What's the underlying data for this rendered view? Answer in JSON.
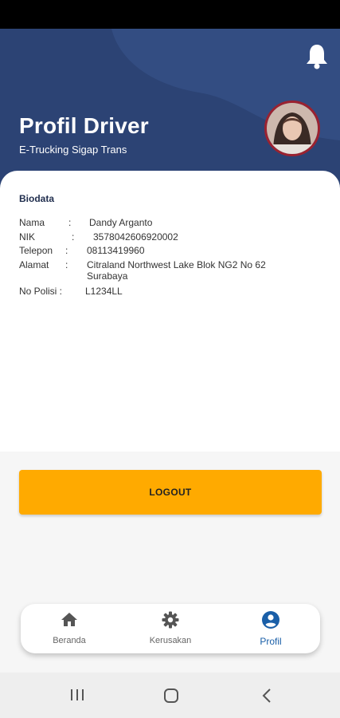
{
  "header": {
    "title": "Profil Driver",
    "subtitle": "E-Trucking Sigap Trans",
    "bg_color": "#2c4374",
    "wave_color": "#334d82",
    "notification_icon": "bell-icon"
  },
  "avatar": {
    "border_color": "#9b2230"
  },
  "biodata": {
    "title": "Biodata",
    "rows": [
      {
        "label": "Nama",
        "sep": ":",
        "value": "Dandy Arganto"
      },
      {
        "label": "NIK",
        "sep": ":",
        "value": "3578042606920002"
      },
      {
        "label": "Telepon",
        "sep": ":",
        "value": "08113419960"
      },
      {
        "label": "Alamat",
        "sep": ":",
        "value": "Citraland Northwest Lake Blok NG2 No 62",
        "value2": "Surabaya"
      },
      {
        "label": "No Polisi :",
        "value": "L1234LL"
      }
    ]
  },
  "logout": {
    "label": "LOGOUT",
    "color": "#ffaa00"
  },
  "bottom_nav": {
    "items": [
      {
        "label": "Beranda",
        "icon": "home-icon",
        "active": false
      },
      {
        "label": "Kerusakan",
        "icon": "gear-icon",
        "active": false
      },
      {
        "label": "Profil",
        "icon": "account-circle-icon",
        "active": true
      }
    ],
    "active_color": "#1a5fa8",
    "inactive_color": "#555555"
  },
  "system_nav": {
    "icons": [
      "recent-apps-icon",
      "home-circle-icon",
      "back-icon"
    ]
  }
}
